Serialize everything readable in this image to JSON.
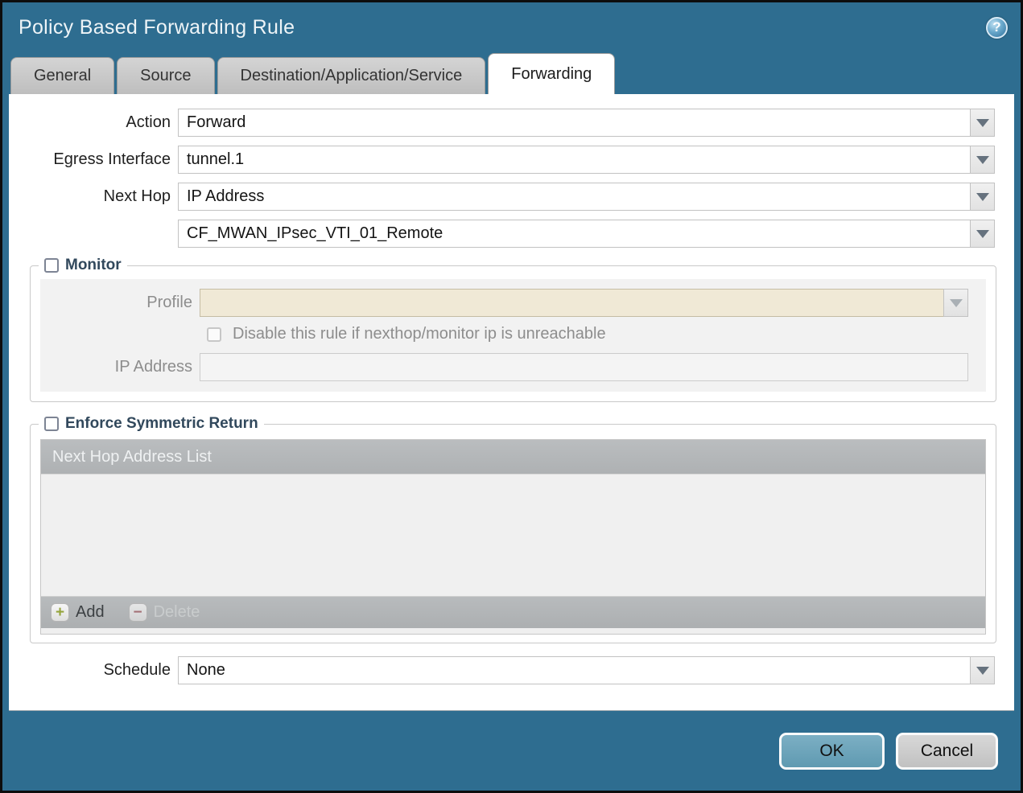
{
  "window": {
    "title": "Policy Based Forwarding Rule"
  },
  "icons": {
    "help": "?",
    "add_plus": "+",
    "delete_minus": "−"
  },
  "tabs": [
    {
      "label": "General",
      "active": false
    },
    {
      "label": "Source",
      "active": false
    },
    {
      "label": "Destination/Application/Service",
      "active": false
    },
    {
      "label": "Forwarding",
      "active": true
    }
  ],
  "form": {
    "action": {
      "label": "Action",
      "value": "Forward"
    },
    "egress_interface": {
      "label": "Egress Interface",
      "value": "tunnel.1"
    },
    "next_hop": {
      "label": "Next Hop",
      "value": "IP Address"
    },
    "next_hop_address": {
      "value": "CF_MWAN_IPsec_VTI_01_Remote"
    },
    "schedule": {
      "label": "Schedule",
      "value": "None"
    }
  },
  "monitor": {
    "title": "Monitor",
    "checked": false,
    "profile": {
      "label": "Profile",
      "value": ""
    },
    "disable_rule": {
      "label": "Disable this rule if nexthop/monitor ip is unreachable",
      "checked": false
    },
    "ip_address": {
      "label": "IP Address",
      "value": ""
    }
  },
  "enforce_symmetric_return": {
    "title": "Enforce Symmetric Return",
    "checked": false,
    "table": {
      "header": "Next Hop Address List",
      "rows": []
    },
    "buttons": {
      "add": "Add",
      "delete": "Delete"
    }
  },
  "footer": {
    "ok": "OK",
    "cancel": "Cancel"
  },
  "colors": {
    "titlebar": "#2e6d90",
    "ok_button": "#6aa3ba",
    "cancel_button": "#c9c9c9",
    "profile_field": "#f0e9d6",
    "table_header": "#b2b5b7",
    "add_plus": "#95a43c",
    "delete_minus": "#9e5a60"
  }
}
